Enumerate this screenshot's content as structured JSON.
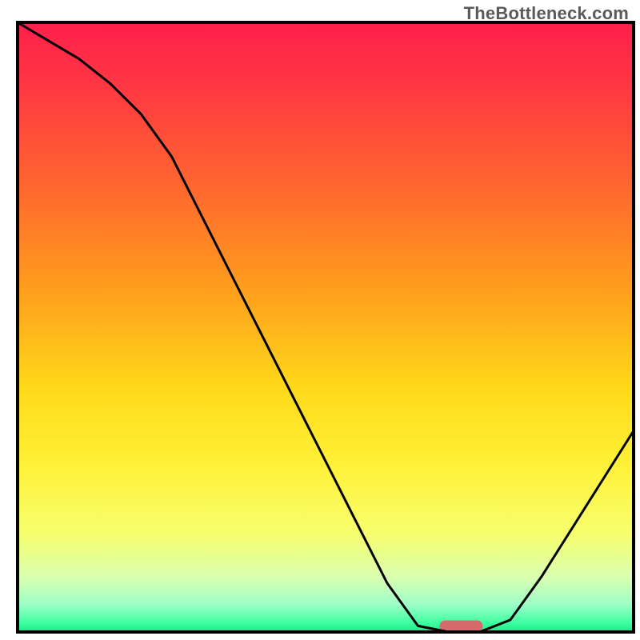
{
  "watermark": "TheBottleneck.com",
  "chart_data": {
    "type": "line",
    "title": "",
    "xlabel": "",
    "ylabel": "",
    "xlim": [
      0,
      100
    ],
    "ylim": [
      0,
      100
    ],
    "grid": false,
    "legend": false,
    "series": [
      {
        "name": "bottleneck-curve",
        "x": [
          0,
          5,
          10,
          15,
          20,
          25,
          30,
          35,
          40,
          45,
          50,
          55,
          60,
          65,
          70,
          75,
          80,
          85,
          90,
          95,
          100
        ],
        "values": [
          100,
          97,
          94,
          90,
          85,
          78,
          68,
          58,
          48,
          38,
          28,
          18,
          8,
          1,
          0,
          0,
          2,
          9,
          17,
          25,
          33
        ]
      }
    ],
    "marker": {
      "x_center": 72,
      "width": 7,
      "color": "#d46a6a"
    },
    "gradient_stops": [
      {
        "offset": 0.0,
        "color": "#ff1f4b"
      },
      {
        "offset": 0.12,
        "color": "#ff3b41"
      },
      {
        "offset": 0.28,
        "color": "#ff6a2d"
      },
      {
        "offset": 0.45,
        "color": "#ffa21c"
      },
      {
        "offset": 0.6,
        "color": "#ffd91a"
      },
      {
        "offset": 0.72,
        "color": "#fff035"
      },
      {
        "offset": 0.84,
        "color": "#f7ff6e"
      },
      {
        "offset": 0.91,
        "color": "#d9ffb0"
      },
      {
        "offset": 0.955,
        "color": "#9dffc8"
      },
      {
        "offset": 0.985,
        "color": "#3effa0"
      },
      {
        "offset": 1.0,
        "color": "#18e98a"
      }
    ]
  }
}
